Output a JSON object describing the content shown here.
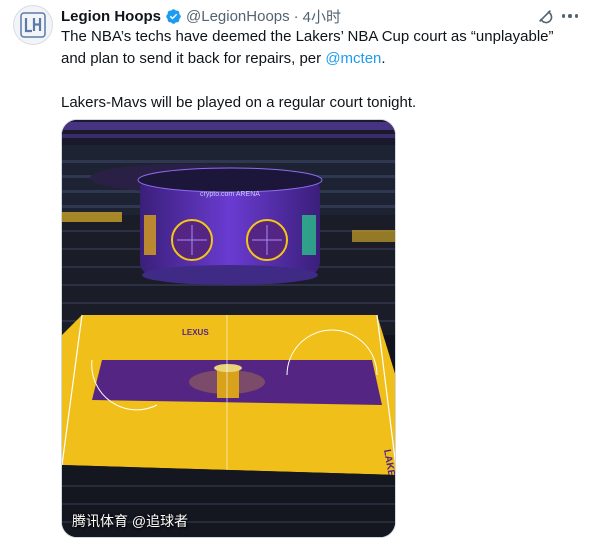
{
  "tweet": {
    "author_name": "Legion Hoops",
    "handle": "@LegionHoops",
    "separator": "·",
    "time": "4小时",
    "text_line1_before": "The NBA’s techs have deemed the Lakers’ NBA Cup court as “unplayable” and plan to send it back for repairs, per ",
    "mention": "@mcten",
    "text_line1_after": ".",
    "text_line2": "Lakers-Mavs will be played on a regular court tonight."
  },
  "icons": {
    "verified": "verified-badge-icon",
    "grok": "grok-icon",
    "more": "more-icon"
  },
  "media": {
    "watermark": "腾讯体育 @追球者",
    "scoreboard_text": "crypto.com ARENA",
    "court_text_baseline": "LAKERS",
    "court_text_sponsor": "LEXUS"
  },
  "colors": {
    "accent_blue": "#1d9bf0",
    "text_primary": "#0f1419",
    "text_secondary": "#536471",
    "lakers_purple": "#552583",
    "lakers_gold": "#f5c518"
  }
}
